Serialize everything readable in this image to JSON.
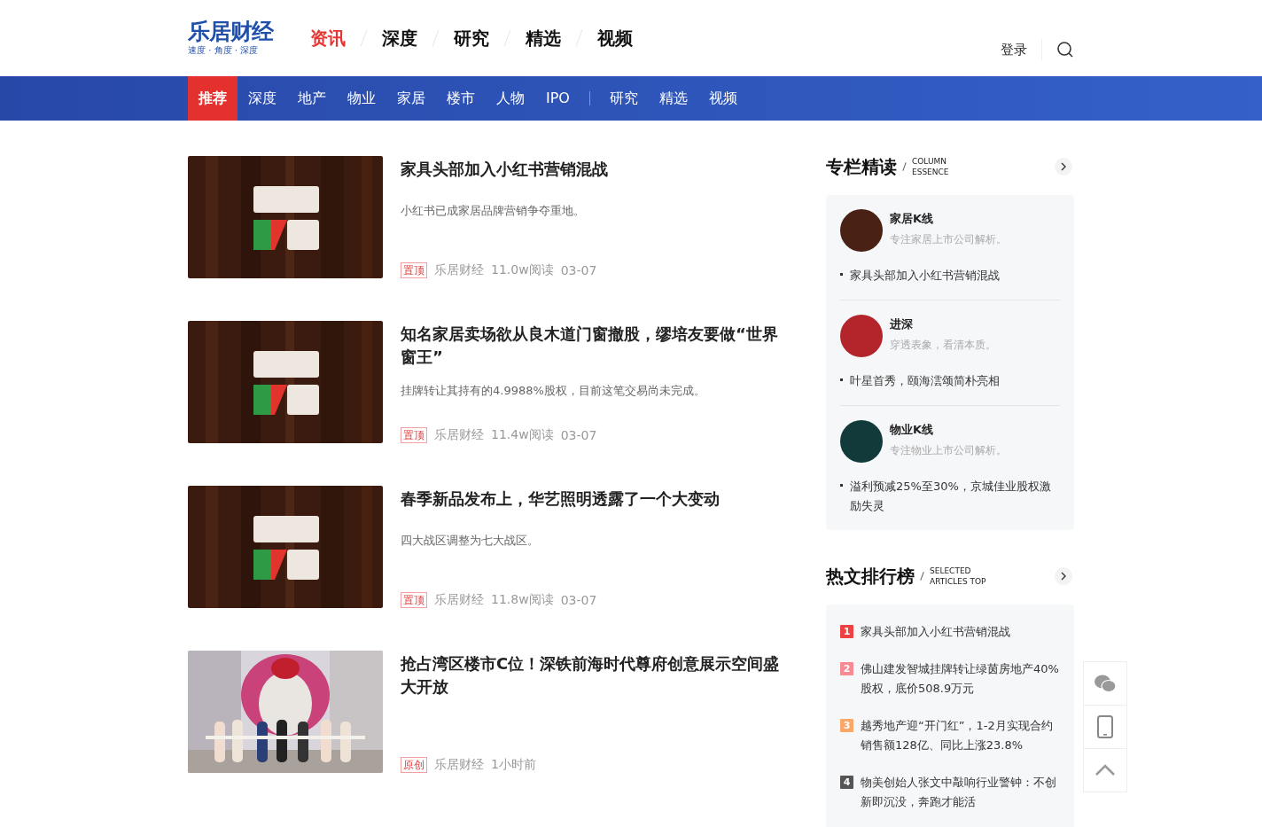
{
  "logo": {
    "name": "乐居财经",
    "slogan": "速度 · 角度 · 深度"
  },
  "main_nav": [
    {
      "label": "资讯",
      "selected": true
    },
    {
      "label": "深度",
      "selected": false
    },
    {
      "label": "研究",
      "selected": false
    },
    {
      "label": "精选",
      "selected": false
    },
    {
      "label": "视频",
      "selected": false
    }
  ],
  "login": "登录",
  "sub_nav": {
    "groups": [
      [
        {
          "label": "推荐",
          "selected": true
        },
        {
          "label": "深度",
          "selected": false
        },
        {
          "label": "地产",
          "selected": false
        },
        {
          "label": "物业",
          "selected": false
        },
        {
          "label": "家居",
          "selected": false
        },
        {
          "label": "楼市",
          "selected": false
        },
        {
          "label": "人物",
          "selected": false
        },
        {
          "label": "IPO",
          "selected": false
        }
      ],
      [
        {
          "label": "研究",
          "selected": false
        },
        {
          "label": "精选",
          "selected": false
        },
        {
          "label": "视频",
          "selected": false
        }
      ]
    ]
  },
  "articles": [
    {
      "kind": "picture",
      "title": "家具头部加入小红书营销混战",
      "summary": "小红书已成家居品牌营销争夺重地。",
      "tag": "置顶",
      "source": "乐居财经",
      "reads": "11.0w阅读",
      "time": "03-07"
    },
    {
      "kind": "picture",
      "title": "知名家居卖场欲从良木道门窗撤股，缪培友要做“世界窗王”",
      "summary": "挂牌转让其持有的4.9988%股权，目前这笔交易尚未完成。",
      "tag": "置顶",
      "source": "乐居财经",
      "reads": "11.4w阅读",
      "time": "03-07"
    },
    {
      "kind": "picture",
      "title": "春季新品发布上，华艺照明透露了一个大变动",
      "summary": "四大战区调整为七大战区。",
      "tag": "置顶",
      "source": "乐居财经",
      "reads": "11.8w阅读",
      "time": "03-07"
    },
    {
      "kind": "picture",
      "title": "抢占湾区楼市C位！深铁前海时代尊府创意展示空间盛大开放",
      "tag": "原创",
      "source": "乐居财经",
      "time": "1小时前"
    }
  ],
  "columns": {
    "title": "专栏精读",
    "subtitle_1": "COLUMN",
    "subtitle_2": "ESSENCE",
    "items": [
      {
        "name": "家居K线",
        "desc": "专注家居上市公司解析。",
        "color": "#4a2115",
        "article": "家具头部加入小红书营销混战"
      },
      {
        "name": "进深",
        "desc": "穿透表象，看清本质。",
        "color": "#b3252b",
        "article": "叶星首秀，颐海澐颂简朴亮相"
      },
      {
        "name": "物业K线",
        "desc": "专注物业上市公司解析。",
        "color": "#123a3a",
        "article": "溢利预减25%至30%，京城佳业股权激励失灵"
      }
    ]
  },
  "ranking": {
    "title": "热文排行榜",
    "subtitle_1": "SELECTED",
    "subtitle_2": "ARTICLES TOP",
    "items": [
      {
        "rank": "1",
        "color": "#f04142",
        "title": "家具头部加入小红书营销混战"
      },
      {
        "rank": "2",
        "color": "#f78a92",
        "title": "佛山建发智城挂牌转让绿茵房地产40%股权，底价508.9万元"
      },
      {
        "rank": "3",
        "color": "#f9a86a",
        "title": "越秀地产迎“开门红”，1-2月实现合约销售额128亿、同比上涨23.8%"
      },
      {
        "rank": "4",
        "color": "#555555",
        "title": "物美创始人张文中敲响行业警钟：不创新即沉没，奔跑才能活"
      }
    ]
  }
}
